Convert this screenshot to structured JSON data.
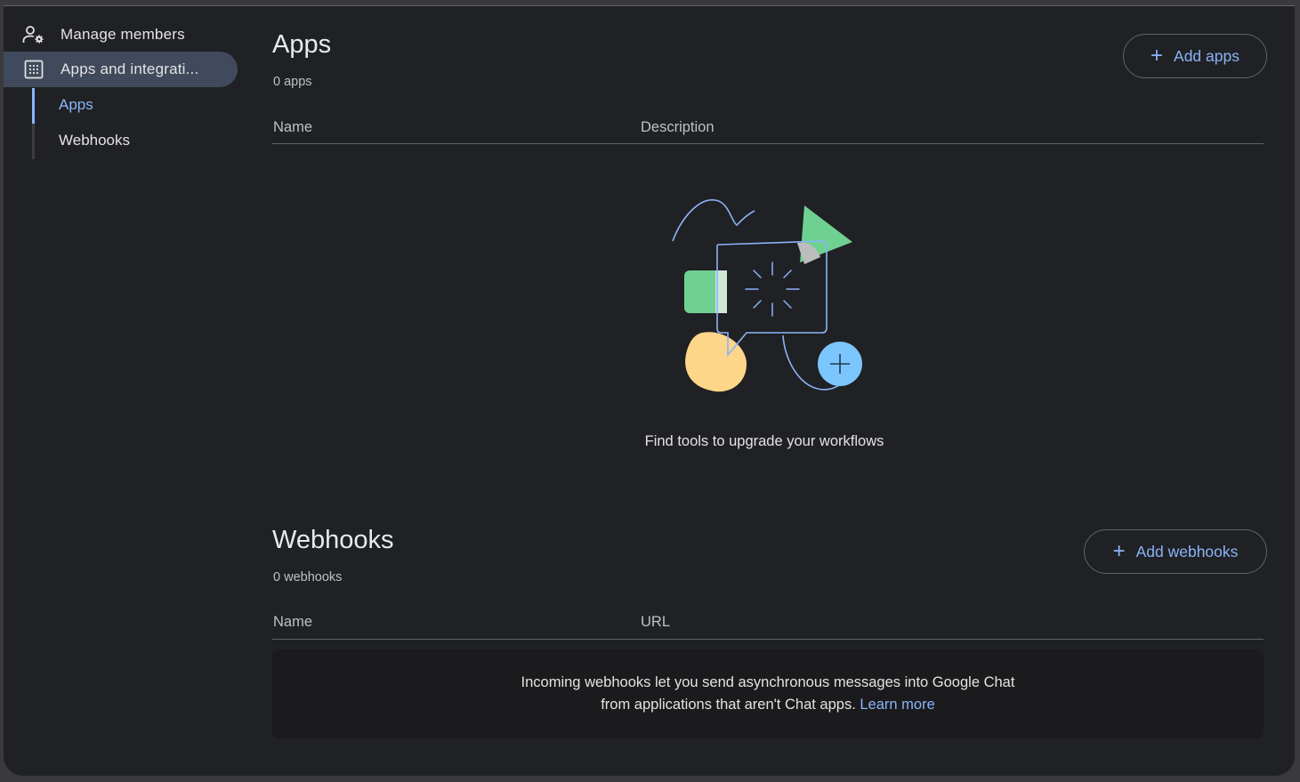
{
  "sidebar": {
    "manage_members": "Manage members",
    "apps_integrations": "Apps and integrati...",
    "sub_apps": "Apps",
    "sub_webhooks": "Webhooks"
  },
  "apps": {
    "title": "Apps",
    "count": "0 apps",
    "add_button": "Add apps",
    "col_name": "Name",
    "col_description": "Description",
    "empty_message": "Find tools to upgrade your workflows"
  },
  "webhooks": {
    "title": "Webhooks",
    "count": "0 webhooks",
    "add_button": "Add webhooks",
    "col_name": "Name",
    "col_url": "URL",
    "info_text": "Incoming webhooks let you send asynchronous messages into Google Chat from applications that aren't Chat apps.",
    "learn_more": "Learn more"
  },
  "icons": {
    "manage_members": "person-settings-icon",
    "apps_integrations": "apps-grid-icon",
    "add": "plus-icon"
  },
  "colors": {
    "accent": "#8ab4f8",
    "selected_nav": "#414a5c",
    "background": "#202124"
  }
}
